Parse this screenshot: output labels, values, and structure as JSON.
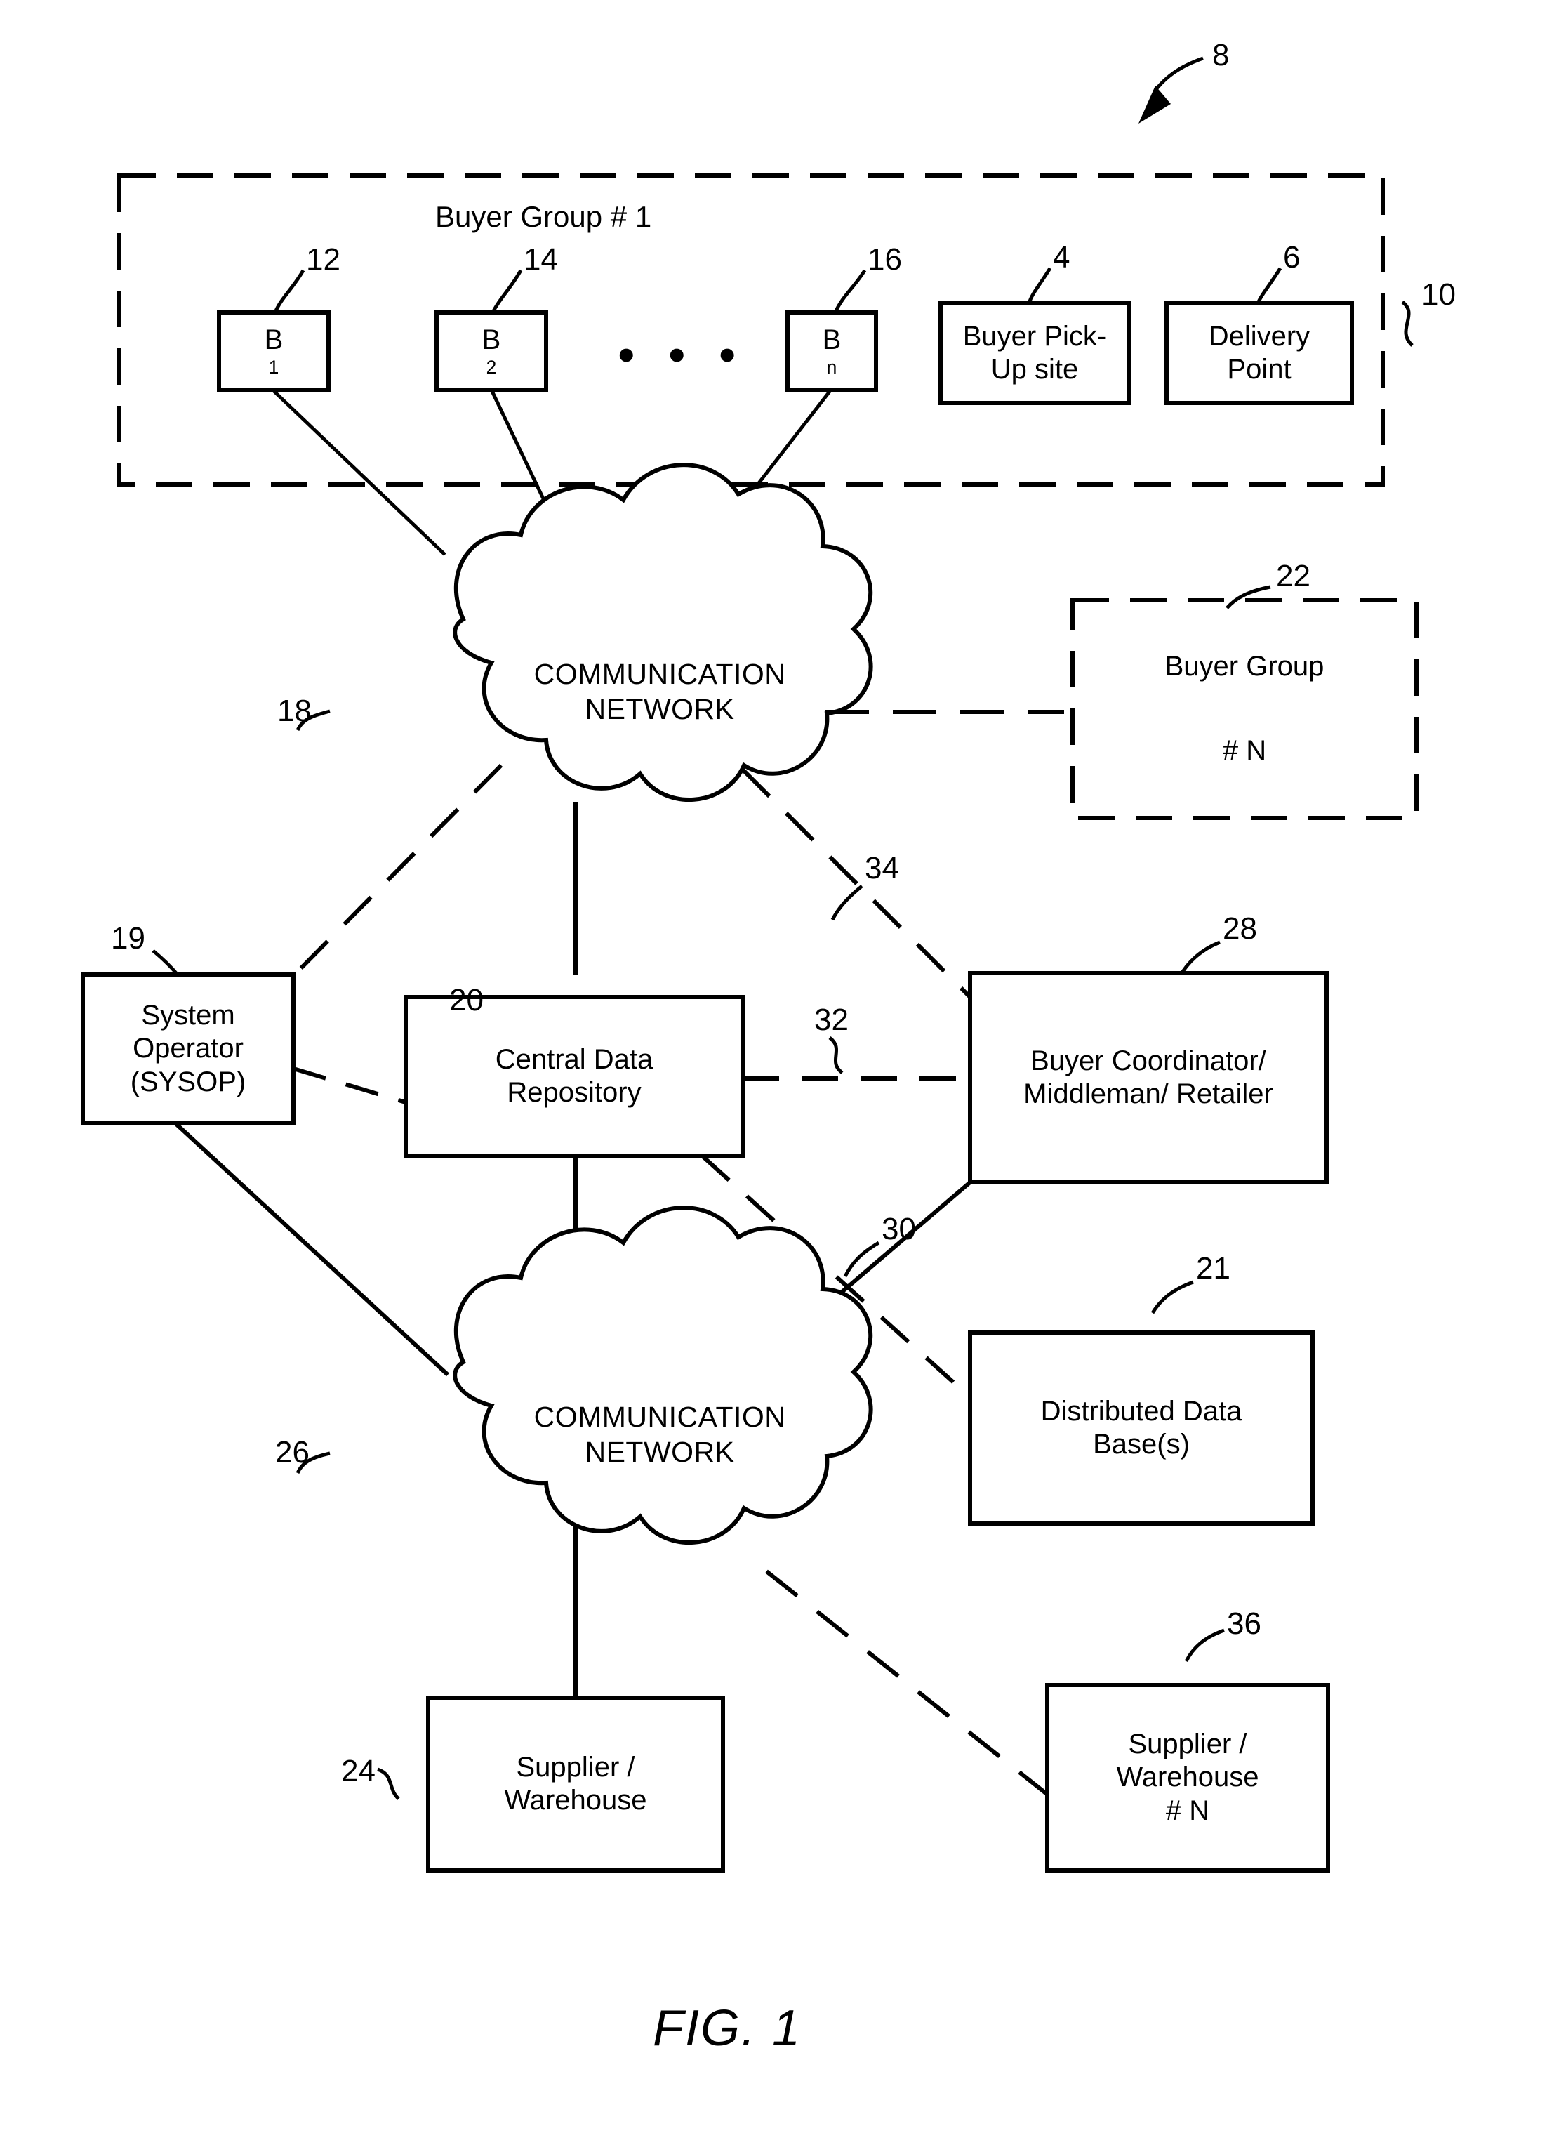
{
  "figure": {
    "caption": "FIG. 1",
    "system_ref": "8"
  },
  "buyer_group_1": {
    "title": "Buyer Group # 1",
    "boundary_ref": "10",
    "ellipsis": "• • •",
    "members": [
      {
        "label_main": "B",
        "label_sub": "1",
        "ref": "12"
      },
      {
        "label_main": "B",
        "label_sub": "2",
        "ref": "14"
      },
      {
        "label_main": "B",
        "label_sub": "n",
        "ref": "16"
      }
    ],
    "facilities": [
      {
        "lines": [
          "Buyer Pick-",
          "Up site"
        ],
        "ref": "4"
      },
      {
        "lines": [
          "Delivery",
          "Point"
        ],
        "ref": "6"
      }
    ]
  },
  "network_top": {
    "lines": [
      "COMMUNICATION",
      "NETWORK"
    ],
    "ref": "18"
  },
  "network_bottom": {
    "lines": [
      "COMMUNICATION",
      "NETWORK"
    ],
    "ref": "26"
  },
  "buyer_group_n": {
    "lines": [
      "Buyer Group",
      "# N"
    ],
    "ref": "22"
  },
  "system_operator": {
    "lines": [
      "System",
      "Operator",
      "(SYSOP)"
    ],
    "ref": "19"
  },
  "central_repository": {
    "lines": [
      "Central Data",
      "Repository"
    ],
    "ref": "20"
  },
  "buyer_coordinator": {
    "lines": [
      "Buyer Coordinator/",
      "Middleman/ Retailer"
    ],
    "ref": "28"
  },
  "distributed_database": {
    "lines": [
      "Distributed Data",
      "Base(s)"
    ],
    "ref": "21"
  },
  "supplier_warehouse": {
    "lines": [
      "Supplier /",
      "Warehouse"
    ],
    "ref": "24"
  },
  "supplier_warehouse_n": {
    "lines": [
      "Supplier /",
      "Warehouse",
      "# N"
    ],
    "ref": "36"
  },
  "link_refs": {
    "coordinator_to_repository": "32",
    "coordinator_to_network_top": "34",
    "coordinator_to_network_bottom": "30"
  },
  "colors": {
    "ink": "#000000",
    "paper": "#ffffff"
  }
}
